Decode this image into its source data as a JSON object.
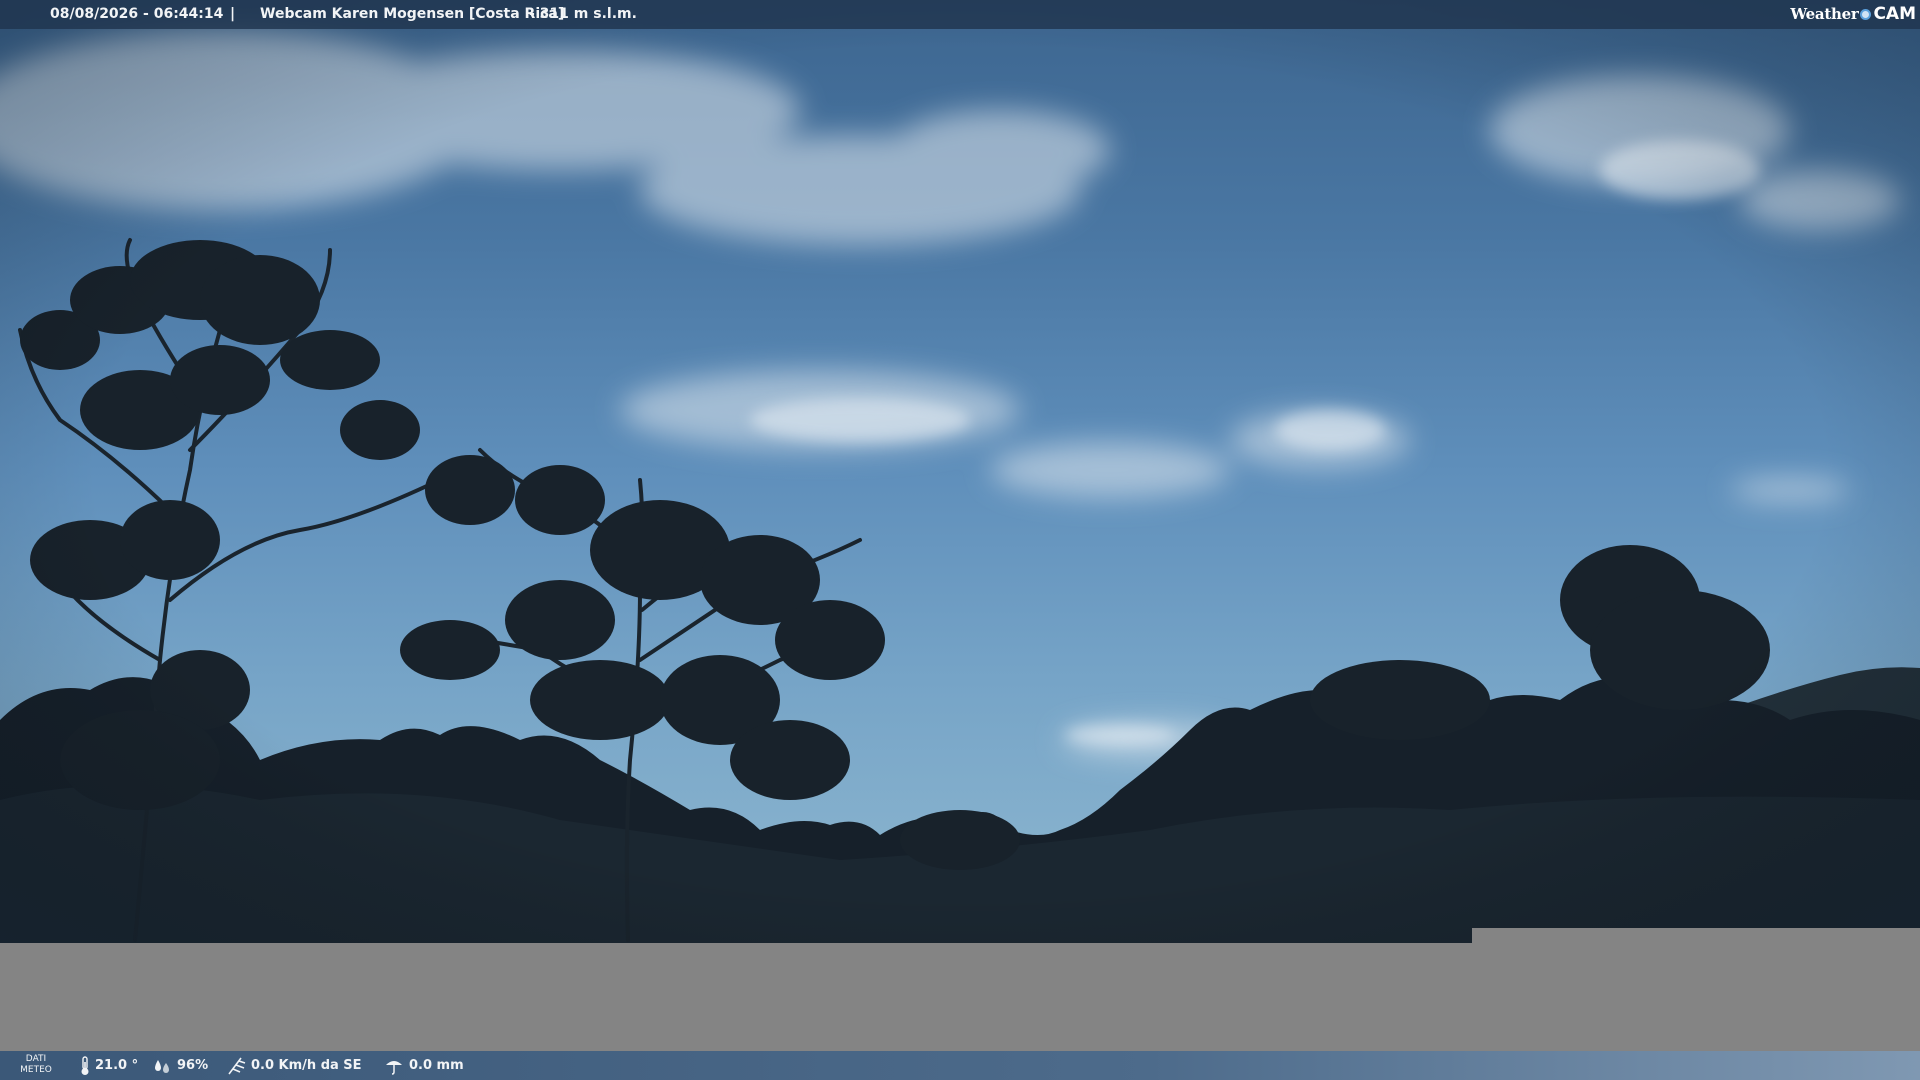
{
  "header": {
    "datetime": "08/08/2026 - 06:44:14",
    "separator": "|",
    "camera_name": "Webcam Karen Mogensen [Costa Rica]",
    "altitude": "- 311 m s.l.m."
  },
  "logo": {
    "word1": "Weather",
    "word2": "CAM"
  },
  "footer": {
    "section_label_line1": "DATI",
    "section_label_line2": "METEO",
    "temperature": "21.0 °",
    "humidity": "96%",
    "wind": "0.0 Km/h da SE",
    "rain": "0.0 mm",
    "icons": [
      "thermometer-icon",
      "humidity-icon",
      "wind-icon",
      "rain-icon"
    ]
  },
  "colors": {
    "sky_top": "#3d6690",
    "sky_bottom": "#86b1cd",
    "vegetation": "#15202a",
    "overlay_bar": "#20344e",
    "placeholder_gray": "#848484"
  }
}
